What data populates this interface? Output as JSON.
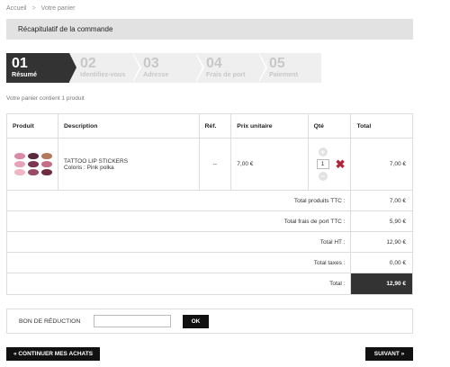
{
  "breadcrumb": {
    "home": "Accueil",
    "separator": ">",
    "current": "Votre panier"
  },
  "page_title": "Récapitulatif de la commande",
  "steps": [
    {
      "num": "01",
      "label": "Résumé",
      "active": true
    },
    {
      "num": "02",
      "label": "Identifiez-vous",
      "active": false
    },
    {
      "num": "03",
      "label": "Adresse",
      "active": false
    },
    {
      "num": "04",
      "label": "Frais de port",
      "active": false
    },
    {
      "num": "05",
      "label": "Paiement",
      "active": false
    }
  ],
  "cart_count": "Votre panier contient 1 produit",
  "table": {
    "headers": {
      "product": "Produit",
      "description": "Description",
      "ref": "Réf.",
      "unit_price": "Prix unitaire",
      "qty": "Qté",
      "total": "Total"
    },
    "item": {
      "name": "TATTOO LIP STICKERS",
      "variant": "Coloris : Pink polka",
      "ref": "--",
      "unit_price": "7,00 €",
      "qty": "1",
      "total": "7,00 €",
      "lip_colors": [
        "#d88aa6",
        "#5a2a3c",
        "#b17a5a",
        "#e6a3b7",
        "#7b3550",
        "#c46e88",
        "#f0b6c4",
        "#9a4a64",
        "#6e2c40"
      ]
    },
    "summary": [
      {
        "label": "Total produits TTC :",
        "value": "7,00 €"
      },
      {
        "label": "Total frais de port TTC :",
        "value": "5,90 €"
      },
      {
        "label": "Total HT :",
        "value": "12,90 €"
      },
      {
        "label": "Total taxes :",
        "value": "0,00 €"
      }
    ],
    "grand_total": {
      "label": "Total :",
      "value": "12,90 €"
    }
  },
  "coupon": {
    "label": "BON DE RÉDUCTION",
    "value": "",
    "ok": "OK"
  },
  "buttons": {
    "back": "« CONTINUER MES ACHATS",
    "next": "SUIVANT »"
  },
  "colors": {
    "dark": "#333333",
    "delete": "#b0243a",
    "title_bg": "#e2e2e2"
  }
}
